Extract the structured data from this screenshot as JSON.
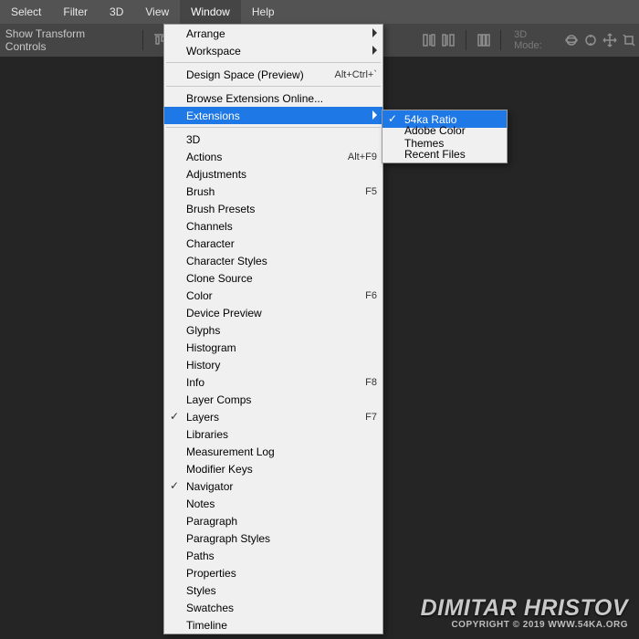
{
  "menubar": {
    "items": [
      "Select",
      "Filter",
      "3D",
      "View",
      "Window",
      "Help"
    ],
    "active_index": 4
  },
  "options_bar": {
    "show_transform_label": "Show Transform Controls",
    "mode_label": "3D Mode:"
  },
  "dropdown": {
    "rows": [
      {
        "label": "Arrange",
        "submenu": true
      },
      {
        "label": "Workspace",
        "submenu": true
      },
      {
        "sep": true
      },
      {
        "label": "Design Space (Preview)",
        "accel": "Alt+Ctrl+`"
      },
      {
        "sep": true
      },
      {
        "label": "Browse Extensions Online..."
      },
      {
        "label": "Extensions",
        "submenu": true,
        "selected": true
      },
      {
        "sep": true
      },
      {
        "label": "3D"
      },
      {
        "label": "Actions",
        "accel": "Alt+F9"
      },
      {
        "label": "Adjustments"
      },
      {
        "label": "Brush",
        "accel": "F5"
      },
      {
        "label": "Brush Presets"
      },
      {
        "label": "Channels"
      },
      {
        "label": "Character"
      },
      {
        "label": "Character Styles"
      },
      {
        "label": "Clone Source"
      },
      {
        "label": "Color",
        "accel": "F6"
      },
      {
        "label": "Device Preview"
      },
      {
        "label": "Glyphs"
      },
      {
        "label": "Histogram"
      },
      {
        "label": "History"
      },
      {
        "label": "Info",
        "accel": "F8"
      },
      {
        "label": "Layer Comps"
      },
      {
        "label": "Layers",
        "accel": "F7",
        "checked": true
      },
      {
        "label": "Libraries"
      },
      {
        "label": "Measurement Log"
      },
      {
        "label": "Modifier Keys"
      },
      {
        "label": "Navigator",
        "checked": true
      },
      {
        "label": "Notes"
      },
      {
        "label": "Paragraph"
      },
      {
        "label": "Paragraph Styles"
      },
      {
        "label": "Paths"
      },
      {
        "label": "Properties"
      },
      {
        "label": "Styles"
      },
      {
        "label": "Swatches"
      },
      {
        "label": "Timeline"
      }
    ]
  },
  "submenu": {
    "rows": [
      {
        "label": "54ka Ratio",
        "selected": true,
        "checked": true
      },
      {
        "label": "Adobe Color Themes"
      },
      {
        "label": "Recent Files"
      }
    ]
  },
  "watermark": {
    "line1": "DIMITAR HRISTOV",
    "line2": "COPYRIGHT © 2019 WWW.54KA.ORG"
  }
}
